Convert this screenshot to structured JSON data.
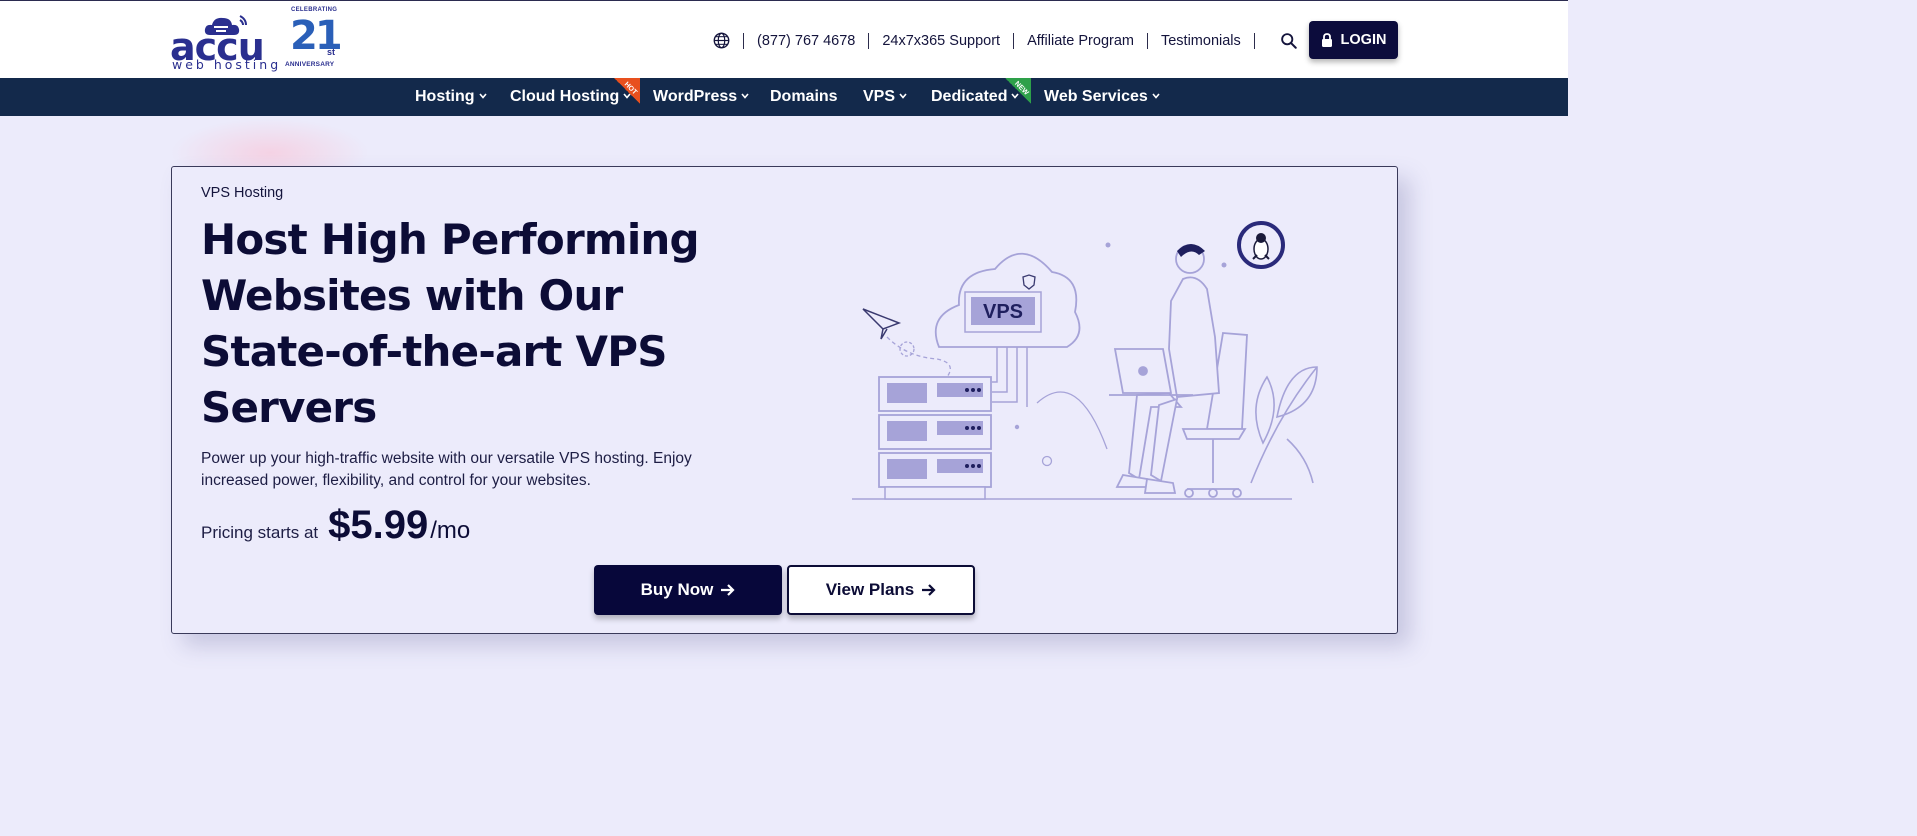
{
  "header": {
    "logo": {
      "wordmark": "accu",
      "tagline": "web hosting"
    },
    "anniversary": {
      "top": "CELEBRATING",
      "number": "21",
      "suffix": "st",
      "word": "ANNIVERSARY"
    },
    "phone": "(877) 767 4678",
    "support": "24x7x365 Support",
    "affiliate": "Affiliate Program",
    "testimonials": "Testimonials",
    "login": "LOGIN"
  },
  "nav": {
    "items": [
      {
        "label": "Hosting"
      },
      {
        "label": "Cloud Hosting",
        "badge": "HOT"
      },
      {
        "label": "WordPress"
      },
      {
        "label": "Domains"
      },
      {
        "label": "VPS"
      },
      {
        "label": "Dedicated",
        "badge": "NEW"
      },
      {
        "label": "Web Services"
      }
    ]
  },
  "hero": {
    "eyebrow": "VPS Hosting",
    "headline": "Host High Performing Websites with Our State-of-the-art VPS Servers",
    "description": "Power up your high-traffic website with our versatile VPS hosting. Enjoy increased power, flexibility, and control for your websites.",
    "pricing_label": "Pricing starts at",
    "price": "$5.99",
    "price_unit": "/mo",
    "buy_label": "Buy Now",
    "plans_label": "View Plans",
    "illustration_label": "VPS"
  },
  "colors": {
    "navy": "#0c0c3c",
    "nav_bg": "#13294b",
    "page_bg": "#ecebfb",
    "hot_badge": "#e8501e",
    "new_badge": "#2ea04a",
    "illustration": "#a6a3d8"
  },
  "icons": [
    "globe-icon",
    "search-icon",
    "lock-icon",
    "chevron-down-icon",
    "arrow-right-icon",
    "linux-penguin-icon",
    "paper-plane-icon"
  ]
}
